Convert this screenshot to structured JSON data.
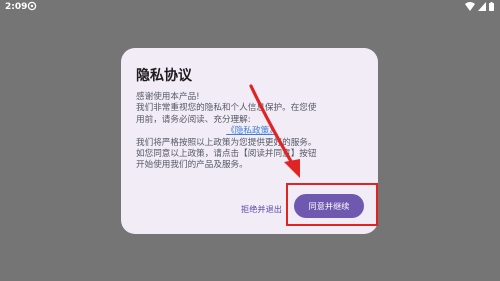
{
  "status_bar": {
    "time": "2:09",
    "icons": [
      "gear-icon",
      "wifi-icon",
      "signal-icon",
      "battery-icon"
    ]
  },
  "dialog": {
    "title": "隐私协议",
    "paragraph1_lines": [
      "感谢使用本产品!",
      "我们非常重视您的隐私和个人信息保护。在您使",
      "用前，请务必阅读、充分理解:"
    ],
    "policy_link": "《隐私政策》",
    "paragraph2_lines": [
      "我们将严格按照以上政策为您提供更好的服务。",
      "如您同意以上政策，请点击【阅读并同意】按钮",
      "开始使用我们的产品及服务。"
    ],
    "reject_button": "拒绝并退出",
    "agree_button": "同意并继续"
  },
  "colors": {
    "background": "#757575",
    "dialog": "#f1ecf6",
    "accent": "#6f58b0",
    "link": "#3f7fd8",
    "annotation": "#e02424"
  }
}
